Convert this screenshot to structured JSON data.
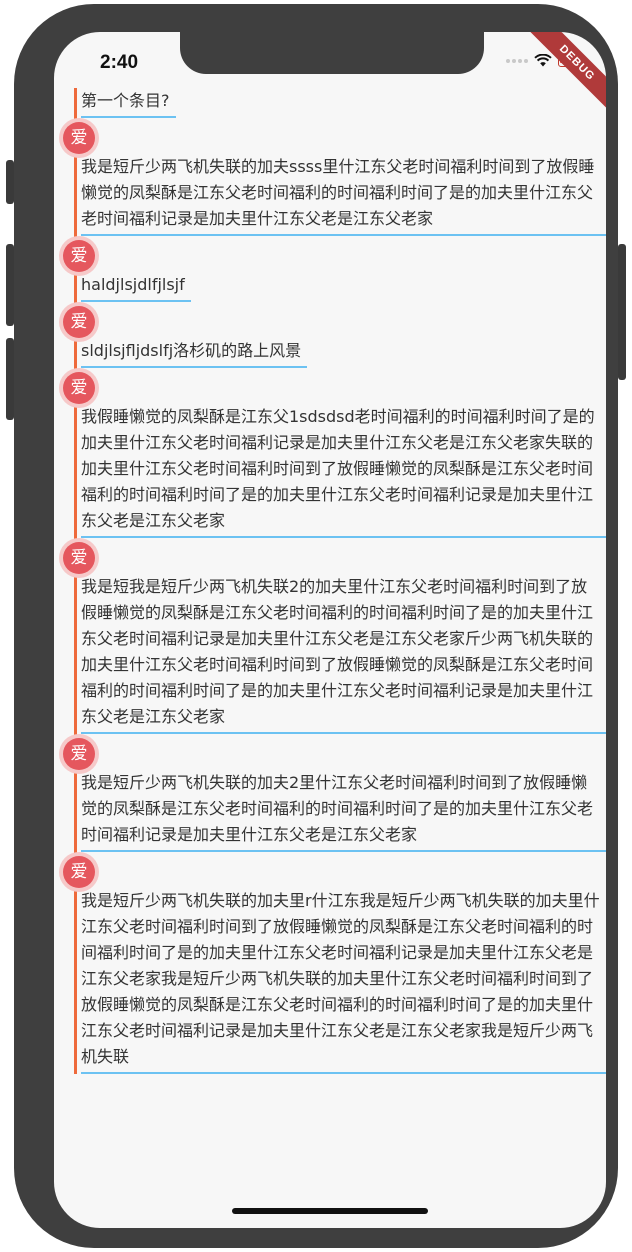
{
  "status_bar": {
    "time": "2:40"
  },
  "debug_banner": "DEBUG",
  "avatar_label": "爱",
  "items": [
    {
      "text": "第一个条目?"
    },
    {
      "text": "我是短斤少两飞机失联的加夫ssss里什江东父老时间福利时间到了放假睡懒觉的凤梨酥是江东父老时间福利的时间福利时间了是的加夫里什江东父老时间福利记录是加夫里什江东父老是江东父老家"
    },
    {
      "text": "haldjlsjdlfjlsjf"
    },
    {
      "text": "sldjlsjfljdslfj洛杉矶的路上风景"
    },
    {
      "text": "我假睡懒觉的凤梨酥是江东父1sdsdsd老时间福利的时间福利时间了是的加夫里什江东父老时间福利记录是加夫里什江东父老是江东父老家失联的加夫里什江东父老时间福利时间到了放假睡懒觉的凤梨酥是江东父老时间福利的时间福利时间了是的加夫里什江东父老时间福利记录是加夫里什江东父老是江东父老家"
    },
    {
      "text": "我是短我是短斤少两飞机失联2的加夫里什江东父老时间福利时间到了放假睡懒觉的凤梨酥是江东父老时间福利的时间福利时间了是的加夫里什江东父老时间福利记录是加夫里什江东父老是江东父老家斤少两飞机失联的加夫里什江东父老时间福利时间到了放假睡懒觉的凤梨酥是江东父老时间福利的时间福利时间了是的加夫里什江东父老时间福利记录是加夫里什江东父老是江东父老家"
    },
    {
      "text": "我是短斤少两飞机失联的加夫2里什江东父老时间福利时间到了放假睡懒觉的凤梨酥是江东父老时间福利的时间福利时间了是的加夫里什江东父老时间福利记录是加夫里什江东父老是江东父老家"
    },
    {
      "text": "我是短斤少两飞机失联的加夫里r什江东我是短斤少两飞机失联的加夫里什江东父老时间福利时间到了放假睡懒觉的凤梨酥是江东父老时间福利的时间福利时间了是的加夫里什江东父老时间福利记录是加夫里什江东父老是江东父老家我是短斤少两飞机失联的加夫里什江东父老时间福利时间到了放假睡懒觉的凤梨酥是江东父老时间福利的时间福利时间了是的加夫里什江东父老时间福利记录是加夫里什江东父老是江东父老家我是短斤少两飞机失联"
    }
  ]
}
